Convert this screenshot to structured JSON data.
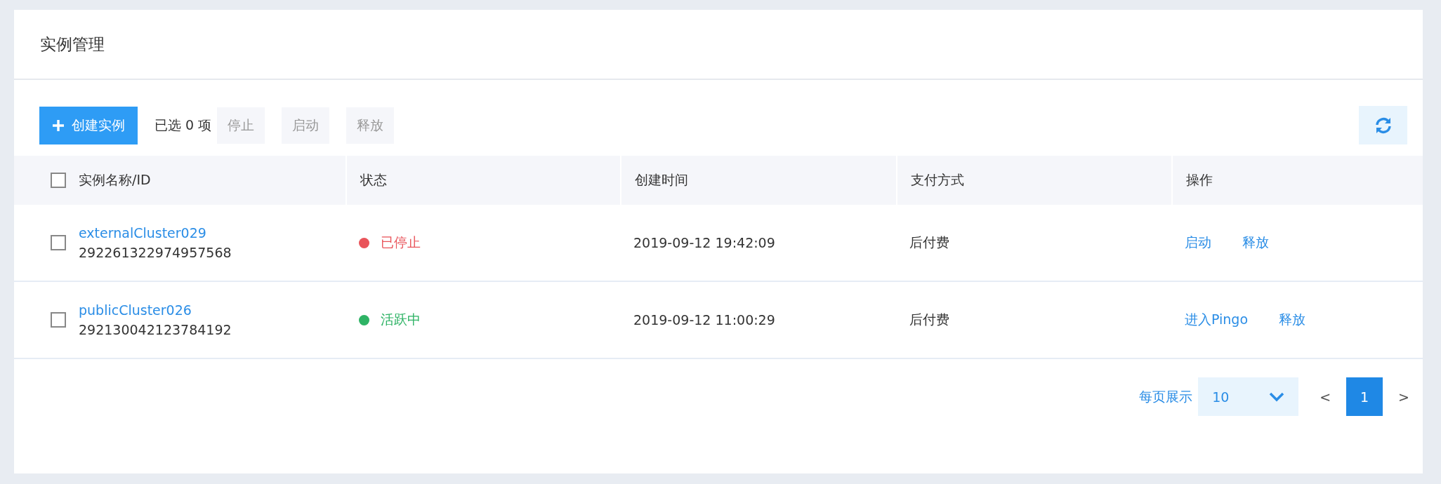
{
  "page": {
    "title": "实例管理"
  },
  "toolbar": {
    "create_button": "创建实例",
    "selection": "已选 0 项",
    "actions": [
      {
        "label": "停止",
        "disabled": true
      },
      {
        "label": "启动",
        "disabled": true
      },
      {
        "label": "释放",
        "disabled": true
      }
    ]
  },
  "table": {
    "select_all": {
      "checked": false
    },
    "columns": [
      "实例名称/ID",
      "状态",
      "创建时间",
      "支付方式",
      "操作"
    ],
    "rows": [
      {
        "checked": false,
        "name": "externalCluster029",
        "id": "292261322974957568",
        "status": "已停止",
        "color": "#e9545a",
        "created": "2019-09-12 19:42:09",
        "payment": "后付费",
        "actions": [
          "启动",
          "释放"
        ]
      },
      {
        "checked": false,
        "name": "publicCluster026",
        "id": "292130042123784192",
        "status": "活跃中",
        "color": "#2eb365",
        "created": "2019-09-12 11:00:29",
        "payment": "后付费",
        "actions": [
          "进入Pingo",
          "释放"
        ]
      }
    ]
  },
  "pagination": {
    "page_size_label": "每页展示",
    "page_size": "10",
    "prev": "<",
    "pages": [
      {
        "label": "1",
        "selected": true
      }
    ],
    "next": ">"
  }
}
